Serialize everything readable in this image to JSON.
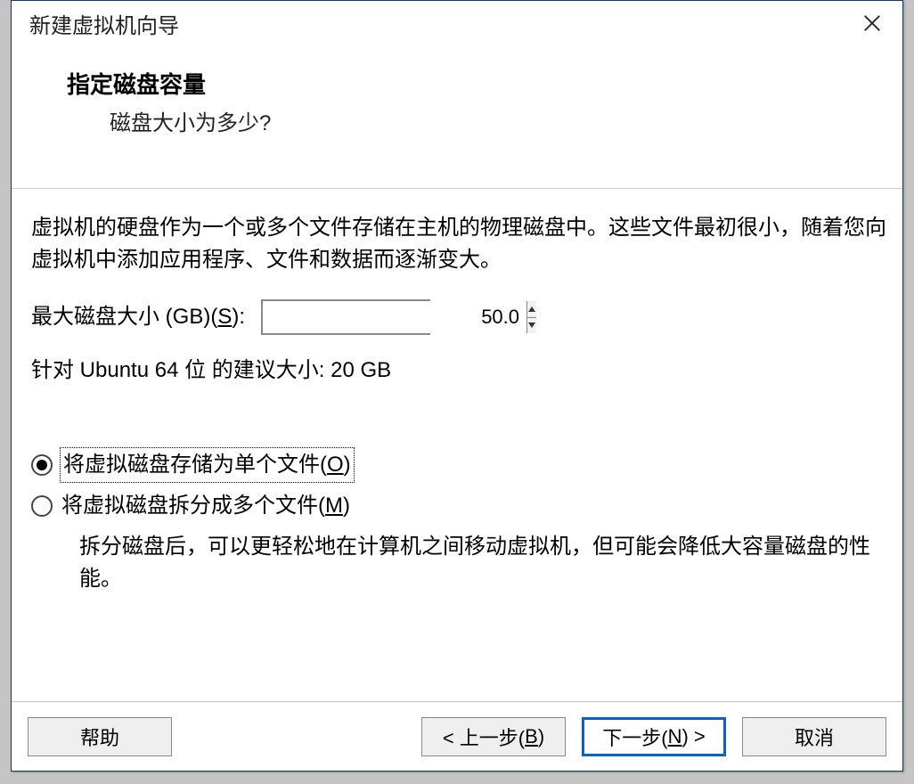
{
  "dialog": {
    "title": "新建虚拟机向导",
    "heading": "指定磁盘容量",
    "subheading": "磁盘大小为多少?",
    "description": "虚拟机的硬盘作为一个或多个文件存储在主机的物理磁盘中。这些文件最初很小，随着您向虚拟机中添加应用程序、文件和数据而逐渐变大。",
    "size_label_pre": "最大磁盘大小 (GB)(",
    "size_label_accel": "S",
    "size_label_post": "):",
    "size_value": "50.0",
    "recommend": "针对 Ubuntu 64 位 的建议大小: 20 GB",
    "radio_single_pre": "将虚拟磁盘存储为单个文件(",
    "radio_single_accel": "O",
    "radio_single_post": ")",
    "radio_split_pre": "将虚拟磁盘拆分成多个文件(",
    "radio_split_accel": "M",
    "radio_split_post": ")",
    "split_desc": "拆分磁盘后，可以更轻松地在计算机之间移动虚拟机，但可能会降低大容量磁盘的性能。",
    "selected_option": "single"
  },
  "buttons": {
    "help": "帮助",
    "back_pre": "< 上一步(",
    "back_accel": "B",
    "back_post": ")",
    "next_pre": "下一步(",
    "next_accel": "N",
    "next_post": ") >",
    "cancel": "取消"
  }
}
